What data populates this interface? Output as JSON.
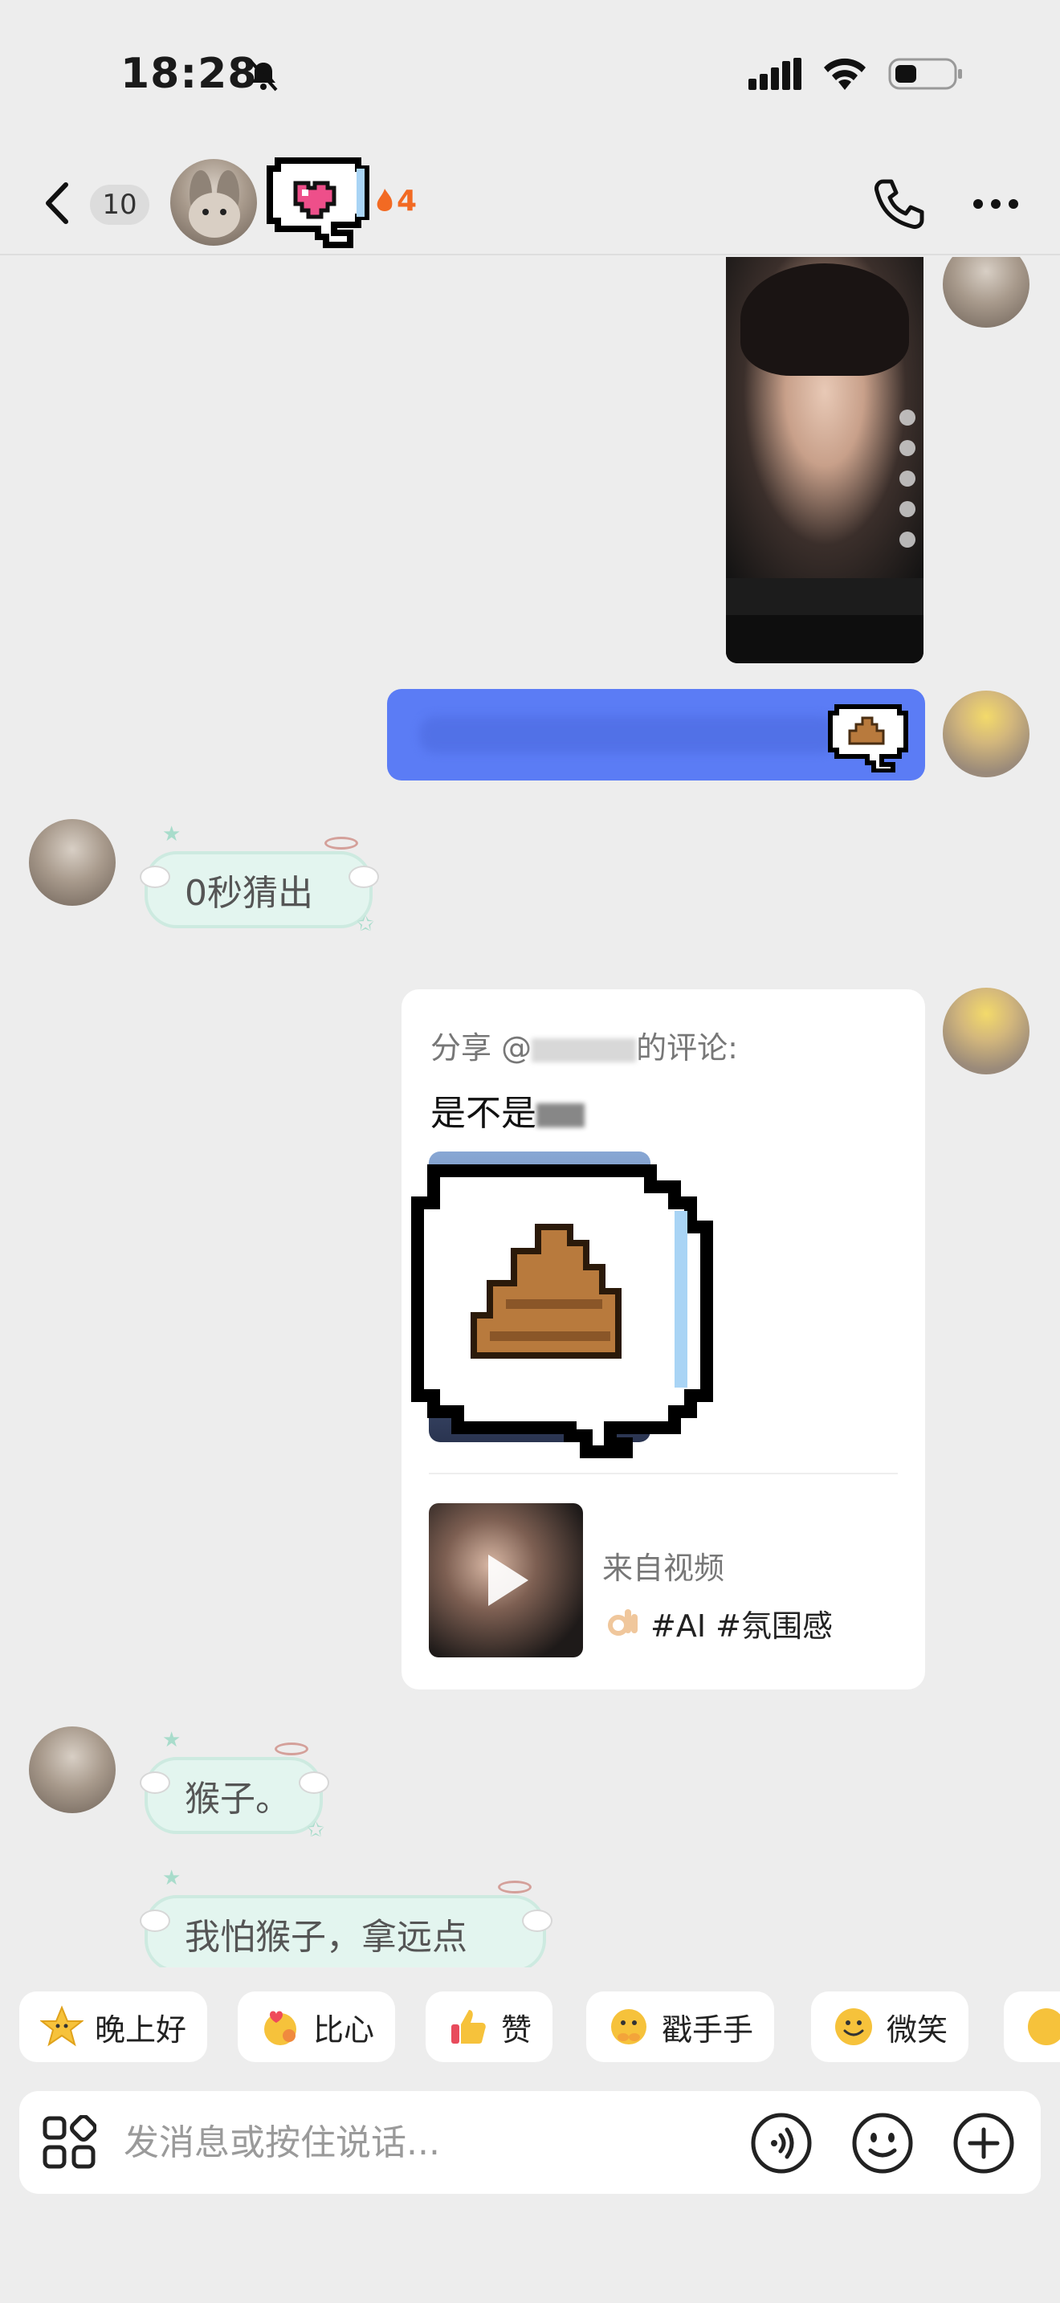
{
  "status_bar": {
    "time": "18:28"
  },
  "header": {
    "unread_count": "10",
    "streak_count": "4"
  },
  "messages": {
    "guess_text": "0秒猜出",
    "share_card": {
      "title_prefix": "分享 @",
      "title_suffix": "的评论:",
      "body_prefix": "是不是",
      "from_label": "来自视频",
      "tags": "#AI #氛围感"
    },
    "monkey_text": "猴子。",
    "afraid_text": "我怕猴子，拿远点"
  },
  "quick_replies": [
    {
      "label": "晚上好",
      "icon": "star-face-icon"
    },
    {
      "label": "比心",
      "icon": "finger-heart-icon"
    },
    {
      "label": "赞",
      "icon": "thumbs-up-icon"
    },
    {
      "label": "戳手手",
      "icon": "poke-hands-icon"
    },
    {
      "label": "微笑",
      "icon": "smile-icon"
    }
  ],
  "input": {
    "placeholder": "发消息或按住说话..."
  },
  "colors": {
    "accent_blue": "#5b7cf5",
    "streak_orange": "#f26a23",
    "pill_mint": "#e3f5ef"
  }
}
